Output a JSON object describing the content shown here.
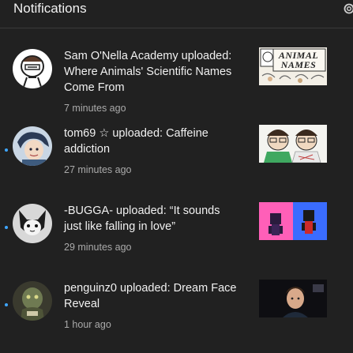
{
  "header": {
    "title": "Notifications",
    "settings_icon": "gear-icon"
  },
  "colors": {
    "background": "#212121",
    "unread_dot": "#3ea6ff",
    "secondary_text": "#aaaaaa"
  },
  "notifications": [
    {
      "title": "Sam O'Nella Academy uploaded: Where Animals' Scientific Names Come From",
      "time": "7 minutes ago",
      "unread": false,
      "thumbnail_text": "ANIMAL NAMES"
    },
    {
      "title": "tom69 ☆ uploaded: Caffeine addiction",
      "time": "27 minutes ago",
      "unread": true
    },
    {
      "title": "-BUGGA- uploaded: “It sounds just like falling in love”",
      "time": "29 minutes ago",
      "unread": true
    },
    {
      "title": "penguinz0 uploaded: Dream Face Reveal",
      "time": "1 hour ago",
      "unread": true
    }
  ]
}
